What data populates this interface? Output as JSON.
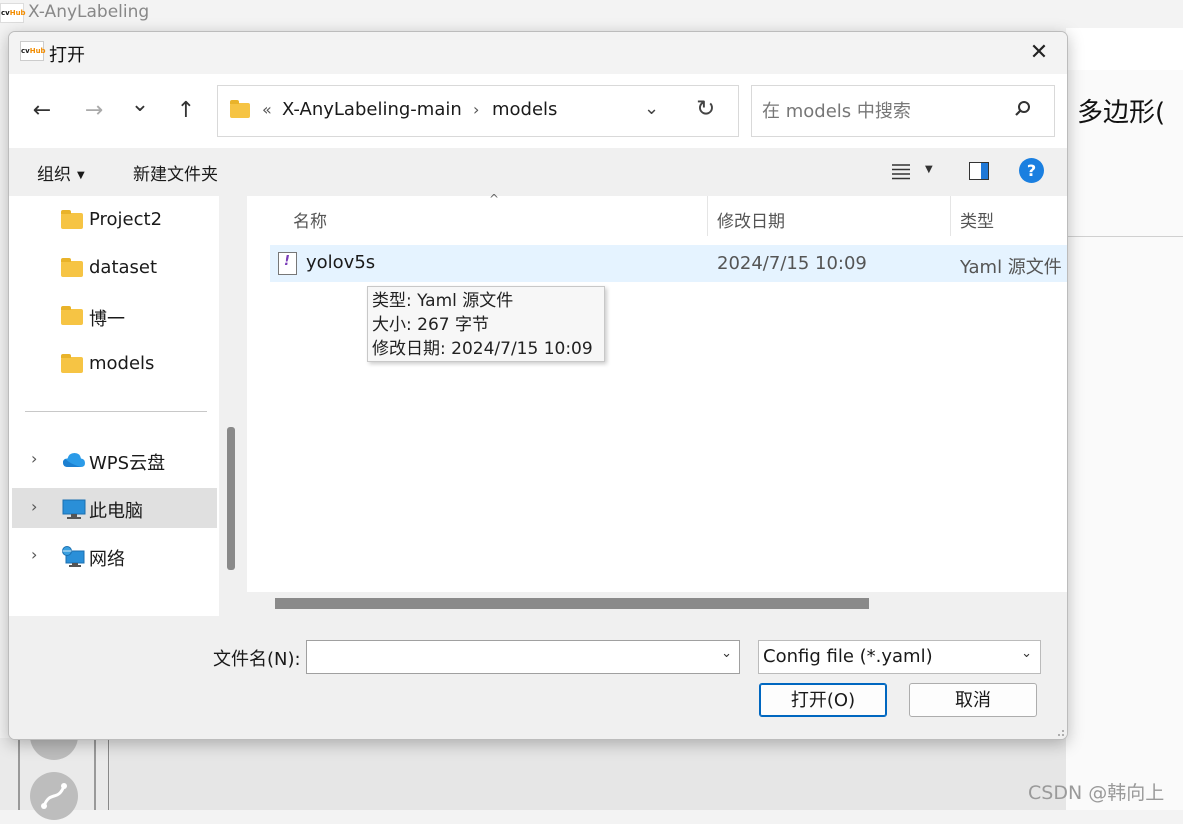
{
  "app": {
    "title": "X-AnyLabeling",
    "logo_text_a": "cv",
    "logo_text_b": "Hub",
    "right_label": "多边形(",
    "watermark": "CSDN @韩向上"
  },
  "dialog": {
    "title": "打开",
    "close_glyph": "✕",
    "nav": {
      "back_glyph": "←",
      "forward_glyph": "→",
      "recent_glyph": "⌄",
      "up_glyph": "↑"
    },
    "address": {
      "overflow": "«",
      "crumbs": [
        "X-AnyLabeling-main",
        "models"
      ],
      "separator": "›",
      "dropdown_glyph": "⌄",
      "refresh_glyph": "↻"
    },
    "search": {
      "placeholder": "在 models 中搜索"
    },
    "toolbar": {
      "organize": "组织",
      "new_folder": "新建文件夹",
      "help": "?"
    },
    "tree": {
      "items": [
        {
          "label": "Project2",
          "icon": "folder-icon"
        },
        {
          "label": "dataset",
          "icon": "folder-icon"
        },
        {
          "label": "博一",
          "icon": "folder-icon"
        },
        {
          "label": "models",
          "icon": "folder-icon"
        },
        {
          "label": "WPS云盘",
          "icon": "cloud-icon"
        },
        {
          "label": "此电脑",
          "icon": "pc-icon"
        },
        {
          "label": "网络",
          "icon": "network-icon"
        }
      ],
      "expand_glyph": "›"
    },
    "columns": {
      "name": "名称",
      "modified": "修改日期",
      "type": "类型"
    },
    "files": [
      {
        "name": "yolov5s",
        "modified": "2024/7/15 10:09",
        "type": "Yaml 源文件"
      }
    ],
    "tooltip": {
      "type_line": "类型: Yaml 源文件",
      "size_line": "大小: 267 字节",
      "date_line": "修改日期: 2024/7/15 10:09"
    },
    "bottom": {
      "filename_label": "文件名(N):",
      "filename_value": "",
      "filetype": "Config file (*.yaml)",
      "open_button": "打开(O)",
      "cancel_button": "取消"
    }
  }
}
